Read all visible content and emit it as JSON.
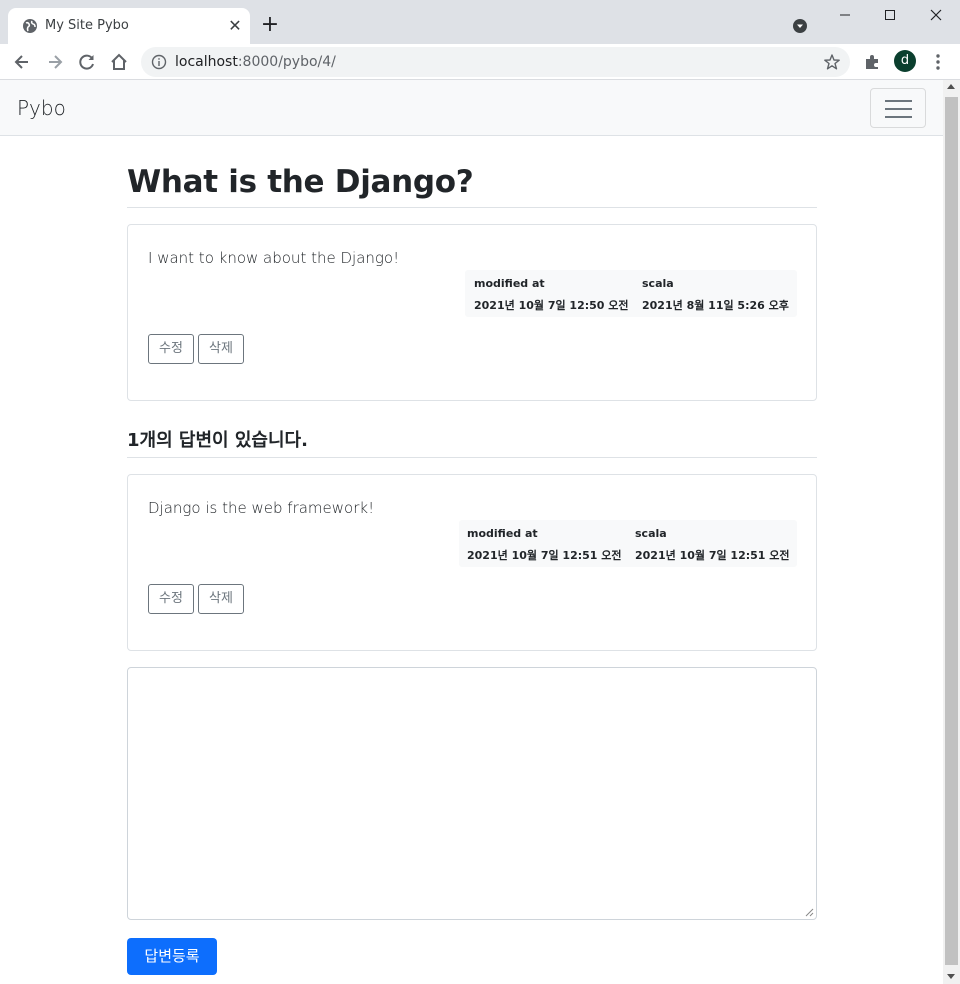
{
  "browser": {
    "tab_title": "My Site Pybo",
    "new_tab_label": "+",
    "url_host": "localhost",
    "url_rest": ":8000/pybo/4/",
    "avatar_letter": "d",
    "window_controls": {
      "minimize": "—",
      "maximize": "☐",
      "close": "✕"
    }
  },
  "navbar": {
    "brand": "Pybo"
  },
  "question": {
    "title": "What is the Django?",
    "content": "I want to know about the Django!",
    "modified_label": "modified at",
    "modified_date": "2021년 10월 7일 12:50 오전",
    "author": "scala",
    "created_date": "2021년 8월 11일 5:26 오후",
    "edit_label": "수정",
    "delete_label": "삭제"
  },
  "answers_header": {
    "count": "1",
    "suffix": "개의 답변이 있습니다."
  },
  "answers": [
    {
      "content": "Django is the web framework!",
      "modified_label": "modified at",
      "modified_date": "2021년 10월 7일 12:51 오전",
      "author": "scala",
      "created_date": "2021년 10월 7일 12:51 오전",
      "edit_label": "수정",
      "delete_label": "삭제"
    }
  ],
  "answer_form": {
    "textarea_value": "",
    "submit_label": "답변등록"
  },
  "colors": {
    "primary": "#0d6efd",
    "secondary": "#6c757d",
    "navbar_bg": "#f8f9fa",
    "chrome_bg": "#dee1e6"
  }
}
